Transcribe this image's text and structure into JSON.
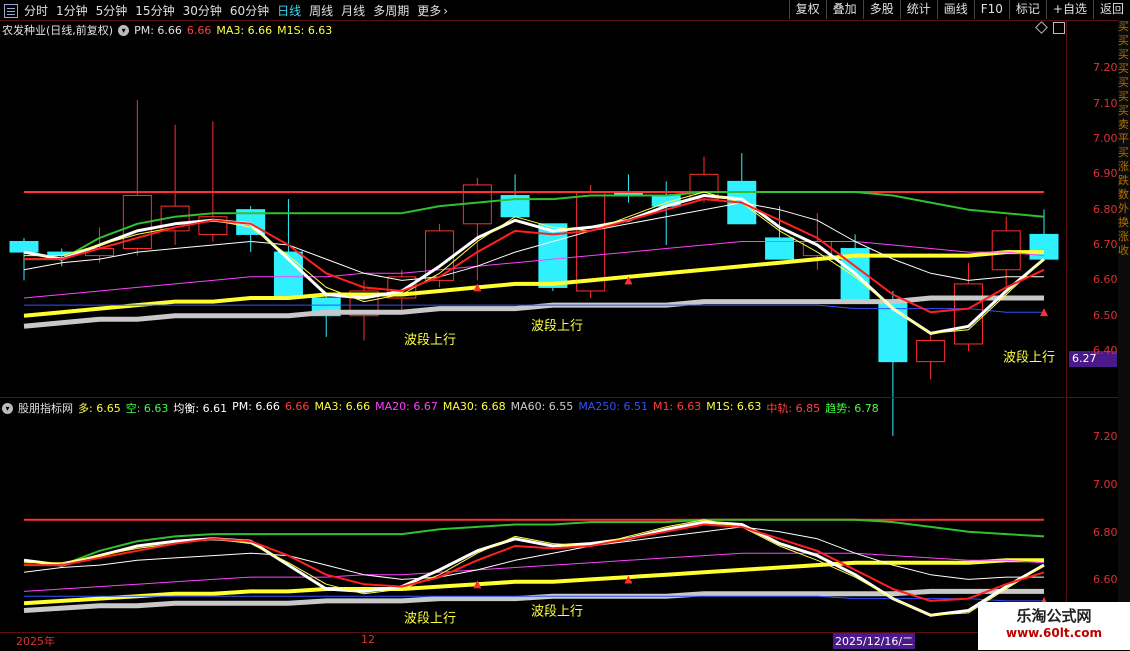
{
  "toolbar": {
    "periods": [
      {
        "label": "分时",
        "active": false
      },
      {
        "label": "1分钟",
        "active": false
      },
      {
        "label": "5分钟",
        "active": false
      },
      {
        "label": "15分钟",
        "active": false
      },
      {
        "label": "30分钟",
        "active": false
      },
      {
        "label": "60分钟",
        "active": false
      },
      {
        "label": "日线",
        "active": true
      },
      {
        "label": "周线",
        "active": false
      },
      {
        "label": "月线",
        "active": false
      },
      {
        "label": "多周期",
        "active": false
      },
      {
        "label": "更多",
        "active": false
      }
    ],
    "more_arrow": "›",
    "buttons": [
      "复权",
      "叠加",
      "多股",
      "统计",
      "画线",
      "F10",
      "标记",
      "+自选",
      "返回"
    ]
  },
  "main_panel": {
    "stock_name": "农发种业(日线,前复权)",
    "indicators": [
      {
        "text": "PM: 6.66",
        "color": "#e0e0e0"
      },
      {
        "text": "6.66",
        "color": "#ff4040"
      },
      {
        "text": "MA3: 6.66",
        "color": "#ffff40"
      },
      {
        "text": "M1S: 6.63",
        "color": "#ffff40"
      }
    ],
    "y_ticks": [
      "7.20",
      "7.10",
      "7.00",
      "6.90",
      "6.80",
      "6.70",
      "6.60",
      "6.50",
      "6.40"
    ],
    "price_tag": "6.27",
    "annotations": [
      "波段上行",
      "波段上行",
      "波段上行"
    ]
  },
  "sub_panel": {
    "name": "股朋指标网",
    "indicators": [
      {
        "text": "多: 6.65",
        "color": "#ffff40"
      },
      {
        "text": "空: 6.63",
        "color": "#40ff40"
      },
      {
        "text": "均衡: 6.61",
        "color": "#ffffff"
      },
      {
        "text": "PM: 6.66",
        "color": "#ffffff"
      },
      {
        "text": "6.66",
        "color": "#ff4040"
      },
      {
        "text": "MA3: 6.66",
        "color": "#ffff40"
      },
      {
        "text": "MA20: 6.67",
        "color": "#ff40ff"
      },
      {
        "text": "MA30: 6.68",
        "color": "#ffff40"
      },
      {
        "text": "MA60: 6.55",
        "color": "#cccccc"
      },
      {
        "text": "MA250: 6.51",
        "color": "#3050ff"
      },
      {
        "text": "M1: 6.63",
        "color": "#ff4040"
      },
      {
        "text": "M1S: 6.63",
        "color": "#ffff40"
      },
      {
        "text": "中轨: 6.85",
        "color": "#ff4040"
      },
      {
        "text": "趋势: 6.78",
        "color": "#40ff40"
      }
    ],
    "y_ticks": [
      "7.20",
      "7.00",
      "6.80",
      "6.60",
      "6.40"
    ],
    "annotations": [
      "波段上行",
      "波段上行"
    ]
  },
  "date_axis": {
    "labels": [
      "2025年",
      "12",
      "2025/12/16/二"
    ]
  },
  "right_strip": {
    "chars": "买买买买买买买卖平买涨跌数外换涨收"
  },
  "watermark": {
    "title": "乐淘公式网",
    "url": "www.60lt.com"
  },
  "colors": {
    "up": "#ff3030",
    "down": "#30f0ff",
    "axis": "#d33",
    "grid": "#5a1010",
    "ma3": "#ffff40",
    "m1": "#ff3030",
    "trend": "#30c030",
    "ma60": "#c8c8c8",
    "ma250": "#3050ff"
  },
  "chart_data": {
    "type": "candlestick",
    "candles": [
      {
        "o": 6.71,
        "h": 6.72,
        "l": 6.6,
        "c": 6.68
      },
      {
        "o": 6.68,
        "h": 6.69,
        "l": 6.64,
        "c": 6.67
      },
      {
        "o": 6.67,
        "h": 6.75,
        "l": 6.65,
        "c": 6.69
      },
      {
        "o": 6.69,
        "h": 7.11,
        "l": 6.67,
        "c": 6.84
      },
      {
        "o": 6.74,
        "h": 7.04,
        "l": 6.7,
        "c": 6.81
      },
      {
        "o": 6.73,
        "h": 7.05,
        "l": 6.71,
        "c": 6.78
      },
      {
        "o": 6.8,
        "h": 6.81,
        "l": 6.68,
        "c": 6.73
      },
      {
        "o": 6.68,
        "h": 6.83,
        "l": 6.55,
        "c": 6.55
      },
      {
        "o": 6.55,
        "h": 6.56,
        "l": 6.44,
        "c": 6.5
      },
      {
        "o": 6.5,
        "h": 6.6,
        "l": 6.43,
        "c": 6.57
      },
      {
        "o": 6.55,
        "h": 6.63,
        "l": 6.51,
        "c": 6.61
      },
      {
        "o": 6.6,
        "h": 6.76,
        "l": 6.58,
        "c": 6.74
      },
      {
        "o": 6.76,
        "h": 6.89,
        "l": 6.6,
        "c": 6.87
      },
      {
        "o": 6.84,
        "h": 6.9,
        "l": 6.78,
        "c": 6.78
      },
      {
        "o": 6.76,
        "h": 6.76,
        "l": 6.57,
        "c": 6.58
      },
      {
        "o": 6.57,
        "h": 6.87,
        "l": 6.55,
        "c": 6.85
      },
      {
        "o": 6.85,
        "h": 6.9,
        "l": 6.82,
        "c": 6.84
      },
      {
        "o": 6.84,
        "h": 6.88,
        "l": 6.7,
        "c": 6.81
      },
      {
        "o": 6.83,
        "h": 6.95,
        "l": 6.82,
        "c": 6.9
      },
      {
        "o": 6.88,
        "h": 6.96,
        "l": 6.81,
        "c": 6.76
      },
      {
        "o": 6.72,
        "h": 6.81,
        "l": 6.67,
        "c": 6.66
      },
      {
        "o": 6.67,
        "h": 6.79,
        "l": 6.63,
        "c": 6.71
      },
      {
        "o": 6.69,
        "h": 6.73,
        "l": 6.54,
        "c": 6.54
      },
      {
        "o": 6.54,
        "h": 6.57,
        "l": 6.16,
        "c": 6.37
      },
      {
        "o": 6.37,
        "h": 6.45,
        "l": 6.32,
        "c": 6.43
      },
      {
        "o": 6.42,
        "h": 6.65,
        "l": 6.4,
        "c": 6.59
      },
      {
        "o": 6.63,
        "h": 6.78,
        "l": 6.57,
        "c": 6.74
      },
      {
        "o": 6.73,
        "h": 6.8,
        "l": 6.66,
        "c": 6.66
      }
    ],
    "series": [
      {
        "name": "中轨",
        "color": "#ff3030",
        "width": 2,
        "values": [
          6.85,
          6.85,
          6.85,
          6.85,
          6.85,
          6.85,
          6.85,
          6.85,
          6.85,
          6.85,
          6.85,
          6.85,
          6.85,
          6.85,
          6.85,
          6.85,
          6.85,
          6.85,
          6.85,
          6.85,
          6.85,
          6.85,
          6.85,
          6.85,
          6.85,
          6.85,
          6.85,
          6.85
        ]
      },
      {
        "name": "趋势",
        "color": "#30c030",
        "width": 2,
        "values": [
          6.66,
          6.66,
          6.72,
          6.76,
          6.78,
          6.79,
          6.79,
          6.79,
          6.79,
          6.79,
          6.79,
          6.81,
          6.82,
          6.83,
          6.83,
          6.84,
          6.84,
          6.84,
          6.85,
          6.85,
          6.85,
          6.85,
          6.85,
          6.84,
          6.82,
          6.8,
          6.79,
          6.78
        ]
      },
      {
        "name": "MA60",
        "color": "#c8c8c8",
        "width": 5,
        "values": [
          6.47,
          6.48,
          6.49,
          6.49,
          6.5,
          6.5,
          6.5,
          6.5,
          6.51,
          6.51,
          6.51,
          6.52,
          6.52,
          6.52,
          6.53,
          6.53,
          6.53,
          6.53,
          6.54,
          6.54,
          6.54,
          6.54,
          6.54,
          6.54,
          6.55,
          6.55,
          6.55,
          6.55
        ]
      },
      {
        "name": "MA30",
        "color": "#ffff30",
        "width": 4,
        "values": [
          6.5,
          6.51,
          6.52,
          6.53,
          6.54,
          6.54,
          6.55,
          6.55,
          6.56,
          6.56,
          6.56,
          6.57,
          6.58,
          6.59,
          6.59,
          6.6,
          6.61,
          6.62,
          6.63,
          6.64,
          6.65,
          6.66,
          6.67,
          6.67,
          6.67,
          6.67,
          6.68,
          6.68
        ]
      },
      {
        "name": "MA250",
        "color": "#3050ff",
        "width": 1,
        "values": [
          6.53,
          6.53,
          6.53,
          6.53,
          6.53,
          6.53,
          6.53,
          6.53,
          6.53,
          6.53,
          6.53,
          6.53,
          6.53,
          6.53,
          6.53,
          6.53,
          6.53,
          6.53,
          6.53,
          6.53,
          6.53,
          6.53,
          6.52,
          6.52,
          6.52,
          6.52,
          6.51,
          6.51
        ]
      },
      {
        "name": "MA20",
        "color": "#ff40ff",
        "width": 1,
        "values": [
          6.55,
          6.56,
          6.57,
          6.58,
          6.59,
          6.6,
          6.61,
          6.61,
          6.61,
          6.62,
          6.62,
          6.63,
          6.64,
          6.65,
          6.66,
          6.67,
          6.68,
          6.69,
          6.7,
          6.71,
          6.71,
          6.71,
          6.71,
          6.7,
          6.69,
          6.68,
          6.68,
          6.67
        ]
      },
      {
        "name": "均衡",
        "color": "#ffffff",
        "width": 1,
        "values": [
          6.63,
          6.65,
          6.66,
          6.68,
          6.69,
          6.7,
          6.71,
          6.7,
          6.66,
          6.62,
          6.6,
          6.61,
          6.64,
          6.68,
          6.71,
          6.74,
          6.76,
          6.78,
          6.8,
          6.82,
          6.8,
          6.77,
          6.71,
          6.66,
          6.62,
          6.6,
          6.61,
          6.61
        ]
      },
      {
        "name": "PM",
        "color": "#ffffff",
        "width": 3,
        "values": [
          6.68,
          6.66,
          6.7,
          6.74,
          6.76,
          6.77,
          6.76,
          6.66,
          6.56,
          6.55,
          6.57,
          6.64,
          6.72,
          6.77,
          6.74,
          6.75,
          6.77,
          6.81,
          6.84,
          6.83,
          6.75,
          6.7,
          6.62,
          6.52,
          6.45,
          6.47,
          6.57,
          6.66
        ]
      },
      {
        "name": "MA3",
        "color": "#ffff40",
        "width": 1,
        "values": [
          6.67,
          6.67,
          6.7,
          6.73,
          6.75,
          6.77,
          6.75,
          6.67,
          6.58,
          6.54,
          6.56,
          6.62,
          6.71,
          6.78,
          6.75,
          6.74,
          6.78,
          6.82,
          6.85,
          6.82,
          6.74,
          6.68,
          6.61,
          6.52,
          6.45,
          6.46,
          6.56,
          6.66
        ]
      },
      {
        "name": "M1",
        "color": "#ff2020",
        "width": 2,
        "values": [
          6.66,
          6.66,
          6.69,
          6.72,
          6.75,
          6.77,
          6.76,
          6.7,
          6.62,
          6.58,
          6.57,
          6.61,
          6.68,
          6.74,
          6.73,
          6.74,
          6.77,
          6.8,
          6.83,
          6.82,
          6.77,
          6.72,
          6.64,
          6.56,
          6.51,
          6.52,
          6.58,
          6.63
        ]
      }
    ],
    "up_arrows": [
      12,
      16,
      30
    ],
    "down_arrows": [
      15,
      27
    ],
    "main_ylim": [
      6.27,
      7.28
    ],
    "sub_ylim": [
      6.38,
      7.28
    ]
  }
}
